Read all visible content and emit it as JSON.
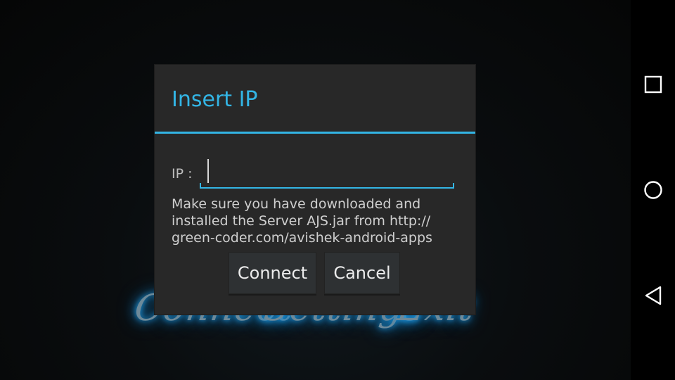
{
  "background_menu": {
    "items": [
      "Connect",
      "Settings",
      "Exit"
    ]
  },
  "dialog": {
    "title": "Insert IP",
    "ip_label": "IP :",
    "ip_value": "",
    "message_lines": [
      "Make sure you have downloaded and",
      "installed the Server AJS.jar from http://",
      "green-coder.com/avishek-android-apps"
    ],
    "buttons": {
      "connect": "Connect",
      "cancel": "Cancel"
    }
  },
  "navbar": {
    "icons": [
      "recent-apps-icon",
      "home-icon",
      "back-icon"
    ]
  },
  "colors": {
    "accent": "#33b5e5",
    "dialog_bg": "#282828",
    "glow": "#1d9be6"
  }
}
